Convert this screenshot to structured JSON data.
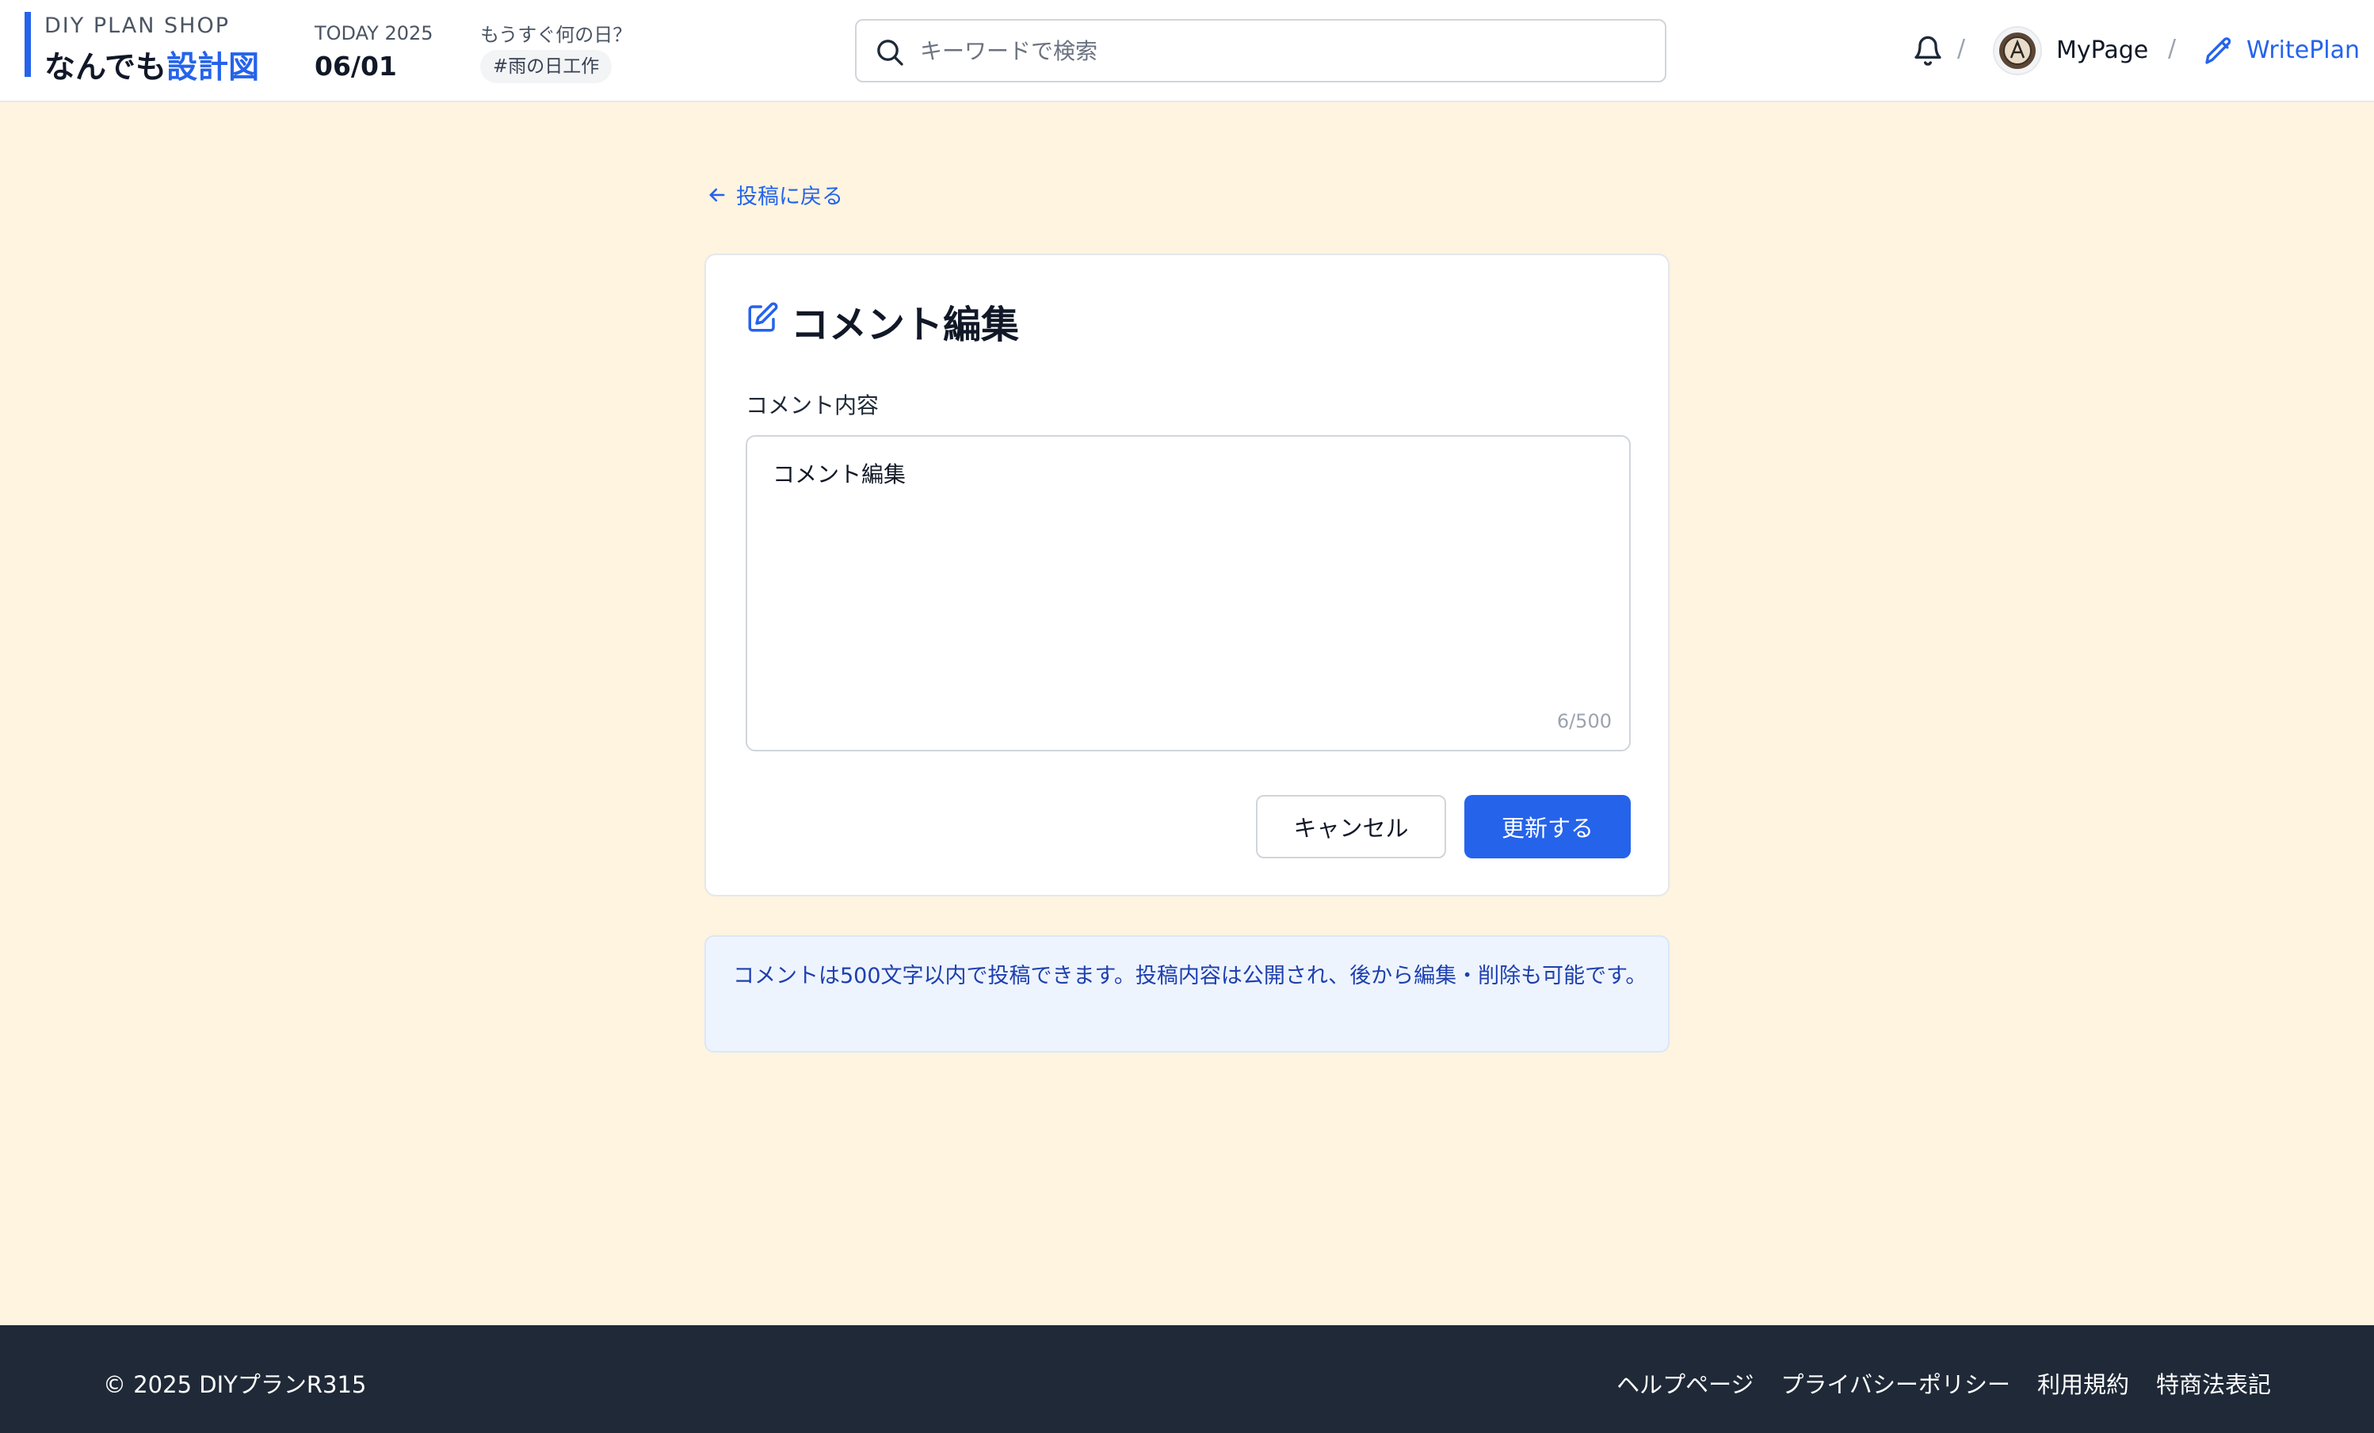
{
  "header": {
    "brand_sub": "DIY PLAN SHOP",
    "brand_main_prefix": "なんでも",
    "brand_main_accent": "設計図",
    "today_label": "TODAY 2025",
    "today_date": "06/01",
    "whatday_label": "もうすぐ何の日？",
    "whatday_tag": "#雨の日工作",
    "search_placeholder": "キーワードで検索",
    "separator": "/",
    "mypage_label": "MyPage",
    "writeplan_label": "WritePlan",
    "icons": [
      "search-icon",
      "bell-icon",
      "avatar",
      "pencil-icon"
    ]
  },
  "main": {
    "back_link": "投稿に戻る",
    "card": {
      "title": "コメント編集",
      "field_label": "コメント内容",
      "comment_value": "コメント編集",
      "char_count": "6/500",
      "cancel_label": "キャンセル",
      "update_label": "更新する"
    },
    "notice": "コメントは500文字以内で投稿できます。投稿内容は公開され、後から編集・削除も可能です。"
  },
  "footer": {
    "copyright": "© 2025 DIYプランR315",
    "links": [
      "ヘルプページ",
      "プライバシーポリシー",
      "利用規約",
      "特商法表記"
    ]
  },
  "colors": {
    "accent": "#2563eb",
    "page_bg": "#fef4df",
    "footer_bg": "#1f2937",
    "notice_bg": "#eef4fe"
  }
}
